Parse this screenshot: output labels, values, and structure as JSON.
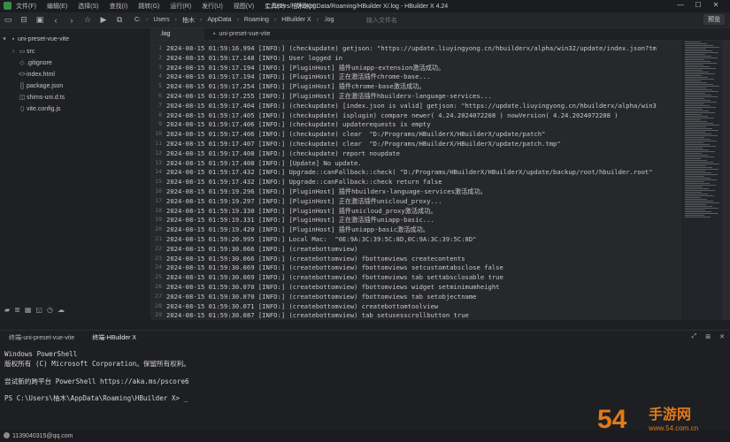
{
  "window": {
    "title": "C:/Users/柚木/AppData/Roaming/HBuilder X/.log - HBuilder X 4.24",
    "menu": [
      "文件(F)",
      "编辑(E)",
      "选择(S)",
      "查找(I)",
      "跳转(G)",
      "运行(R)",
      "发行(U)",
      "视图(V)",
      "工具(T)",
      "帮助(Y)"
    ]
  },
  "toolbar": {
    "breadcrumb": [
      "C:",
      "Users",
      "柚木",
      "AppData",
      "Roaming",
      "HBuilder X",
      ".log"
    ],
    "search_placeholder": "输入文件名",
    "preview_label": "预览"
  },
  "sidebar": {
    "project": "uni-preset-vue-vite",
    "items": [
      {
        "name": "src",
        "type": "folder"
      },
      {
        "name": ".gitignore",
        "type": "file"
      },
      {
        "name": "index.html",
        "type": "file"
      },
      {
        "name": "package.json",
        "type": "file"
      },
      {
        "name": "shims-uni.d.ts",
        "type": "file"
      },
      {
        "name": "vite.config.js",
        "type": "file"
      }
    ]
  },
  "tabs": [
    {
      "label": ".log",
      "active": true
    },
    {
      "label": "uni-preset-vue-vite",
      "active": false
    }
  ],
  "log_lines": [
    "2024-08-15 01:59:16.994 [INFO:] (checkupdate) getjson: \"https://update.liuyingyong.cn/hbuilderx/alpha/win32/update/index.json?tm",
    "2024-08-15 01:59:17.148 [INFO:] User logged in",
    "2024-08-15 01:59:17.194 [INFO:] [PluginHost] 插件uniapp-extension激活成功。",
    "2024-08-15 01:59:17.194 [INFO:] [PluginHost] 正在激活插件chrome-base...",
    "2024-08-15 01:59:17.254 [INFO:] [PluginHost] 插件chrome-base激活成功。",
    "2024-08-15 01:59:17.255 [INFO:] [PluginHost] 正在激活插件hbuilderx-language-services...",
    "2024-08-15 01:59:17.404 [INFO:] (checkupdate) [index.json is valid] getjson: \"https://update.liuyingyong.cn/hbuilderx/alpha/win3",
    "2024-08-15 01:59:17.405 [INFO:] (checkupdate) isplugin) compare newer( 4.24.2024072208 ) nowVersion( 4.24.2024072208 )",
    "2024-08-15 01:59:17.406 [INFO:] (checkupdate) updaterequests is empty",
    "2024-08-15 01:59:17.406 [INFO:] (checkupdate) clear  \"D:/Programs/HBuilderX/HBuilderX/update/patch\"",
    "2024-08-15 01:59:17.407 [INFO:] (checkupdate) clear  \"D:/Programs/HBuilderX/HBuilderX/update/patch.tmp\"",
    "2024-08-15 01:59:17.408 [INFO:] (checkupdate) report noupdate",
    "2024-08-15 01:59:17.408 [INFO:] [Update] No update.",
    "2024-08-15 01:59:17.432 [INFO:] Upgrade::canFallback::check( \"D:/Programs/HBuilderX/HBuilderX/update/backup/root/hbuilder.root\"",
    "2024-08-15 01:59:17.432 [INFO:] Upgrade::canFallback::check return false",
    "2024-08-15 01:59:19.296 [INFO:] [PluginHost] 插件hbuilderx-language-services激活成功。",
    "2024-08-15 01:59:19.297 [INFO:] [PluginHost] 正在激活插件unicloud_proxy...",
    "2024-08-15 01:59:19.330 [INFO:] [PluginHost] 插件unicloud_proxy激活成功。",
    "2024-08-15 01:59:19.331 [INFO:] [PluginHost] 正在激活插件uniapp-basic...",
    "2024-08-15 01:59:19.420 [INFO:] [PluginHost] 插件uniapp-basic激活成功。",
    "2024-08-15 01:59:20.995 [INFO:] Local Mac:  \"0E:9A:3C:39:5C:8D,0C:9A:3C:39:5C:8D\"",
    "2024-08-15 01:59:30.066 [INFO:] (createbottomview)",
    "2024-08-15 01:59:30.066 [INFO:] (createbottomview) fbottomviews createcontents",
    "2024-08-15 01:59:30.069 [INFO:] (createbottomview) fbottomviews setcustomtabsclose false",
    "2024-08-15 01:59:30.069 [INFO:] (createbottomview) fbottomviews tab settabsclosable true",
    "2024-08-15 01:59:30.070 [INFO:] (createbottomview) fbottomviews widget setminimumheight",
    "2024-08-15 01:59:30.070 [INFO:] (createbottomview) fbottomviews tab setobjectname",
    "2024-08-15 01:59:30.071 [INFO:] (createbottomview) createbottomtoolview",
    "2024-08-15 01:59:30.087 [INFO:] (createbottomview) tab setusesscrollbutton true"
  ],
  "terminal": {
    "tabs": [
      "终端-uni-preset-vue-vite",
      "终端-HBuilder X"
    ],
    "active_tab": 1,
    "lines": [
      "Windows PowerShell",
      "版权所有 (C) Microsoft Corporation。保留所有权利。",
      "",
      "尝试新的跨平台 PowerShell https://aka.ms/pscore6",
      "",
      "PS C:\\Users\\柚木\\AppData\\Roaming\\HBuilder X> _"
    ]
  },
  "status": {
    "user": "1139040315@qq.com"
  },
  "watermark": {
    "text": "54",
    "text2": "手游网",
    "url": "www.54.com.cn"
  }
}
